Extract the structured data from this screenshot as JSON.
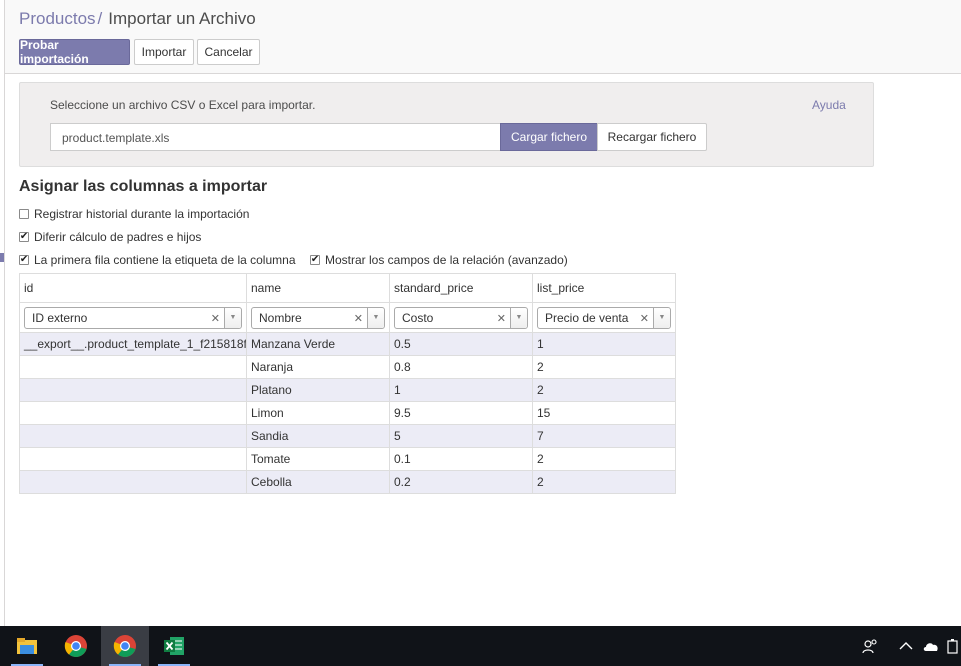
{
  "breadcrumb": {
    "parent": "Productos",
    "separator": "/",
    "current": "Importar un Archivo"
  },
  "toolbar": {
    "test_label": "Probar importación",
    "import_label": "Importar",
    "cancel_label": "Cancelar"
  },
  "file_panel": {
    "help_text": "Seleccione un archivo CSV o Excel para importar.",
    "help_link": "Ayuda",
    "file_name": "product.template.xls",
    "load_label": "Cargar fichero",
    "reload_label": "Recargar fichero"
  },
  "mapping": {
    "title": "Asignar las columnas a importar",
    "options": [
      {
        "label": "Registrar historial durante la importación",
        "checked": false
      },
      {
        "label": "Diferir cálculo de padres e hijos",
        "checked": true
      },
      {
        "label": "La primera fila contiene la etiqueta de la columna",
        "checked": true
      },
      {
        "label": "Mostrar los campos de la relación (avanzado)",
        "checked": true
      }
    ]
  },
  "table": {
    "headers": [
      "id",
      "name",
      "standard_price",
      "list_price"
    ],
    "field_selects": [
      "ID externo",
      "Nombre",
      "Costo",
      "Precio de venta"
    ],
    "rows": [
      [
        "__export__.product_template_1_f215818f",
        "Manzana Verde",
        "0.5",
        "1"
      ],
      [
        "",
        "Naranja",
        "0.8",
        "2"
      ],
      [
        "",
        "Platano",
        "1",
        "2"
      ],
      [
        "",
        "Limon",
        "9.5",
        "15"
      ],
      [
        "",
        "Sandia",
        "5",
        "7"
      ],
      [
        "",
        "Tomate",
        "0.1",
        "2"
      ],
      [
        "",
        "Cebolla",
        "0.2",
        "2"
      ]
    ]
  },
  "taskbar": {
    "apps": [
      "file-explorer-icon",
      "chrome-icon",
      "chrome-icon",
      "excel-icon"
    ],
    "tray": [
      "people-icon",
      "chevron-up-icon",
      "onedrive-icon",
      "battery-icon"
    ]
  },
  "colors": {
    "accent": "#7c7bad",
    "row_stripe": "#ececf6",
    "taskbar": "#101318"
  }
}
